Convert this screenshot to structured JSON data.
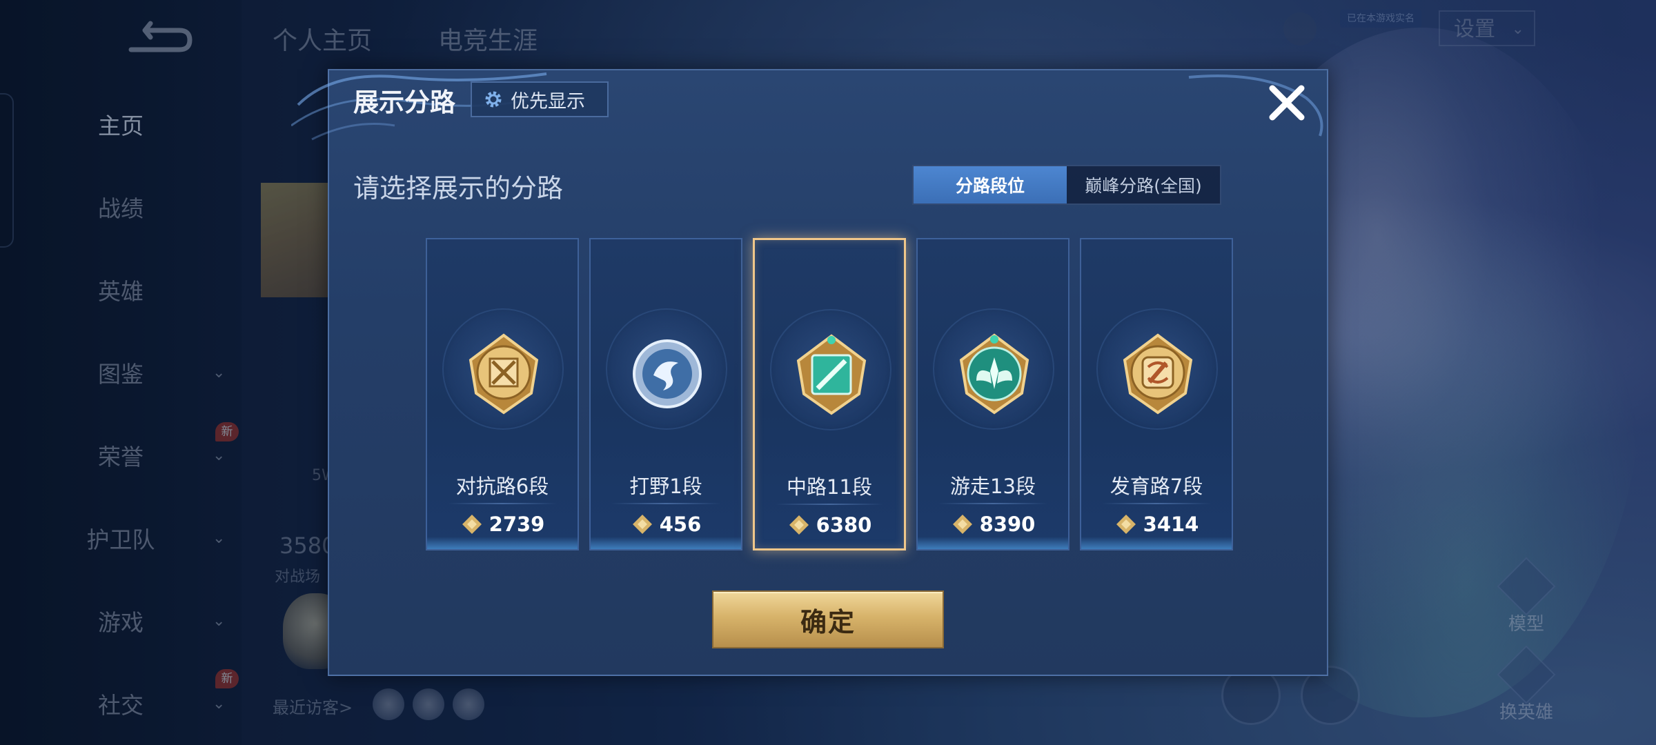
{
  "background": {
    "sidebar": {
      "items": [
        {
          "label": "主页",
          "has_chevron": false
        },
        {
          "label": "战绩",
          "has_chevron": false
        },
        {
          "label": "英雄",
          "has_chevron": false
        },
        {
          "label": "图鉴",
          "has_chevron": true
        },
        {
          "label": "荣誉",
          "has_chevron": true
        },
        {
          "label": "护卫队",
          "has_chevron": true
        },
        {
          "label": "游戏",
          "has_chevron": true
        },
        {
          "label": "社交",
          "has_chevron": true
        }
      ],
      "new_badge": "新"
    },
    "top_tabs": [
      "个人主页",
      "电竞生涯"
    ],
    "settings_label": "设置",
    "top_badge": "已在本游戏实名",
    "stat_value": "3580",
    "stat_sub": "对战场",
    "small_text": "5W",
    "recent_visitors": "最近访客>",
    "right_actions": [
      "模型",
      "换英雄"
    ]
  },
  "dialog": {
    "title": "展示分路",
    "priority_button": "优先显示",
    "subtitle": "请选择展示的分路",
    "toggle": {
      "options": [
        "分路段位",
        "巅峰分路(全国)"
      ],
      "selected": "分路段位"
    },
    "lanes": [
      {
        "label": "对抗路6段",
        "score": "2739",
        "icon": "clash-lane-badge-icon",
        "selected": false
      },
      {
        "label": "打野1段",
        "score": "456",
        "icon": "jungle-badge-icon",
        "selected": false
      },
      {
        "label": "中路11段",
        "score": "6380",
        "icon": "mid-lane-badge-icon",
        "selected": true
      },
      {
        "label": "游走13段",
        "score": "8390",
        "icon": "roam-badge-icon",
        "selected": false
      },
      {
        "label": "发育路7段",
        "score": "3414",
        "icon": "farm-lane-badge-icon",
        "selected": false
      }
    ],
    "confirm_label": "确定"
  },
  "colors": {
    "accent_blue": "#3b6fb6",
    "selected_border": "#f0c78a",
    "confirm_gold": "#d7b36a"
  }
}
